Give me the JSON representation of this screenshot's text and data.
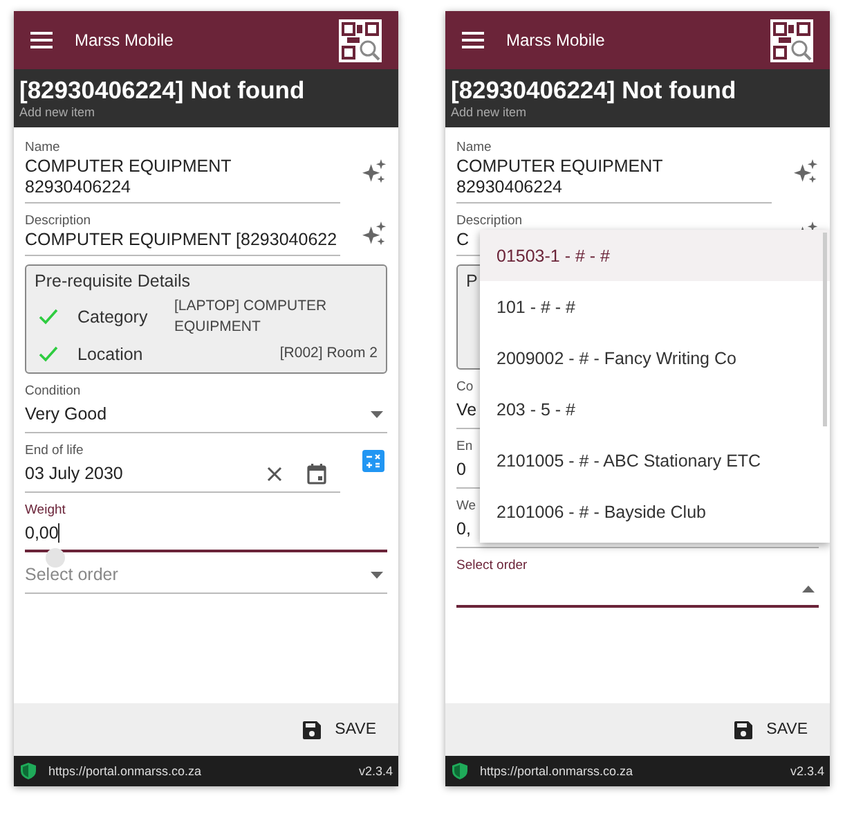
{
  "screens": [
    {
      "app_title": "Marss Mobile",
      "heading": "[82930406224] Not found",
      "subheading": "Add new item",
      "fields": [
        {
          "kind": "text",
          "label": "Name",
          "value": "COMPUTER EQUIPMENT 82930406224"
        },
        {
          "kind": "text",
          "label": "Description",
          "value": "COMPUTER EQUIPMENT [8293040622"
        },
        {
          "kind": "prereq",
          "title": "Pre-requisite Details",
          "rows": [
            {
              "label": "Category",
              "value": "[LAPTOP] COMPUTER EQUIPMENT",
              "checked": true
            },
            {
              "label": "Location",
              "value": "[R002] Room 2",
              "checked": true
            }
          ]
        },
        {
          "kind": "select",
          "label": "Condition",
          "value": "Very Good",
          "focused": false
        },
        {
          "kind": "date",
          "label": "End of life",
          "value": "03 July 2030"
        },
        {
          "kind": "number",
          "label": "Weight",
          "value": "0,00",
          "focused": true,
          "cursor_handle": true
        },
        {
          "kind": "select",
          "placeholder": "Select order",
          "focused": false
        }
      ],
      "save_button": "SAVE",
      "url": "https://portal.onmarss.co.za",
      "version": "v2.3.4"
    },
    {
      "app_title": "Marss Mobile",
      "heading": "[82930406224] Not found",
      "subheading": "Add new item",
      "fields": [
        {
          "kind": "text",
          "label": "Name",
          "value": "COMPUTER EQUIPMENT 82930406224"
        },
        {
          "kind": "text",
          "label": "Description",
          "value": "C"
        },
        {
          "kind": "prereq",
          "title": "P"
        },
        {
          "kind": "select",
          "label": "Co",
          "value": "Ve"
        },
        {
          "kind": "date",
          "label": "En",
          "value": "0"
        },
        {
          "kind": "number",
          "label": "We",
          "value": "0,",
          "focused": false,
          "cursor_handle": false
        },
        {
          "kind": "select",
          "label": "Select order",
          "focused": true
        }
      ],
      "dropdown": {
        "options": [
          {
            "text": "01503-1 - # - #",
            "selected": true
          },
          {
            "text": "101 - # - #",
            "selected": false
          },
          {
            "text": "2009002 - # - Fancy Writing Co",
            "selected": false
          },
          {
            "text": "203 - 5 - #",
            "selected": false
          },
          {
            "text": "2101005 - # - ABC Stationary ETC",
            "selected": false
          },
          {
            "text": "2101006 - # - Bayside Club",
            "selected": false
          }
        ]
      },
      "save_button": "SAVE",
      "url": "https://portal.onmarss.co.za",
      "version": "v2.3.4"
    }
  ]
}
